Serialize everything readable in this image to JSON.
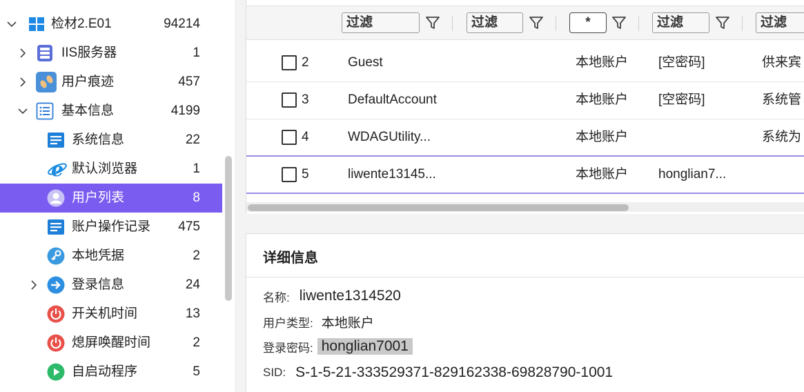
{
  "tree": {
    "items": [
      {
        "label": "检材2.E01",
        "count": "94214"
      },
      {
        "label": "IIS服务器",
        "count": "1"
      },
      {
        "label": "用户痕迹",
        "count": "457"
      },
      {
        "label": "基本信息",
        "count": "4199"
      },
      {
        "label": "系统信息",
        "count": "22"
      },
      {
        "label": "默认浏览器",
        "count": "1"
      },
      {
        "label": "用户列表",
        "count": "8"
      },
      {
        "label": "账户操作记录",
        "count": "475"
      },
      {
        "label": "本地凭据",
        "count": "2"
      },
      {
        "label": "登录信息",
        "count": "24"
      },
      {
        "label": "开关机时间",
        "count": "13"
      },
      {
        "label": "熄屏唤醒时间",
        "count": "2"
      },
      {
        "label": "自启动程序",
        "count": "5"
      }
    ]
  },
  "filters": [
    {
      "text": "过滤"
    },
    {
      "text": "过滤"
    },
    {
      "text": "*"
    },
    {
      "text": "过滤"
    },
    {
      "text": "过滤"
    }
  ],
  "table": {
    "rows": [
      {
        "num": "2",
        "name": "Guest",
        "type": "本地账户",
        "password": "[空密码]",
        "desc": "供来宾"
      },
      {
        "num": "3",
        "name": "DefaultAccount",
        "type": "本地账户",
        "password": "[空密码]",
        "desc": "系统管"
      },
      {
        "num": "4",
        "name": "WDAGUtility...",
        "type": "本地账户",
        "password": "",
        "desc": "系统为"
      },
      {
        "num": "5",
        "name": "liwente13145...",
        "type": "本地账户",
        "password": "honglian7...",
        "desc": ""
      }
    ]
  },
  "details": {
    "title": "详细信息",
    "name_label": "名称:",
    "name_value": "liwente1314520",
    "type_label": "用户类型:",
    "type_value": "本地账户",
    "password_label": "登录密码:",
    "password_value": "honglian7001",
    "sid_label": "SID:",
    "sid_value": "S-1-5-21-333529371-829162338-69828790-1001"
  },
  "colors": {
    "selected": "#7b5cf0",
    "row_divider": "#9b8ce6"
  }
}
